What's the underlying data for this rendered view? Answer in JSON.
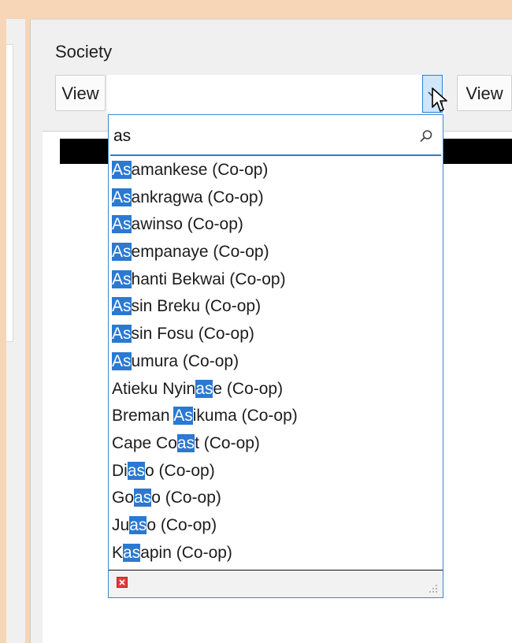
{
  "society": {
    "label": "Society",
    "view_left_label": "View",
    "view_right_label": "View",
    "search_value": "as",
    "items": [
      {
        "pre": "",
        "match": "As",
        "post": "amankese (Co-op)"
      },
      {
        "pre": "",
        "match": "As",
        "post": "ankragwa (Co-op)"
      },
      {
        "pre": "",
        "match": "As",
        "post": "awinso (Co-op)"
      },
      {
        "pre": "",
        "match": "As",
        "post": "empanaye (Co-op)"
      },
      {
        "pre": "",
        "match": "As",
        "post": "hanti Bekwai (Co-op)"
      },
      {
        "pre": "",
        "match": "As",
        "post": "sin Breku (Co-op)"
      },
      {
        "pre": "",
        "match": "As",
        "post": "sin Fosu (Co-op)"
      },
      {
        "pre": "",
        "match": "As",
        "post": "umura (Co-op)"
      },
      {
        "pre": "Atieku Nyin",
        "match": "as",
        "post": "e (Co-op)"
      },
      {
        "pre": "Breman ",
        "match": "As",
        "post": "ikuma (Co-op)"
      },
      {
        "pre": "Cape Co",
        "match": "as",
        "post": "t (Co-op)"
      },
      {
        "pre": "Di",
        "match": "as",
        "post": "o (Co-op)"
      },
      {
        "pre": "Go",
        "match": "as",
        "post": "o (Co-op)"
      },
      {
        "pre": "Ju",
        "match": "as",
        "post": "o (Co-op)"
      },
      {
        "pre": "K",
        "match": "as",
        "post": "apin (Co-op)"
      }
    ]
  },
  "icons": {
    "dropdown_arrow": "chevron-down-icon",
    "search": "search-icon",
    "clear": "clear-filter-icon",
    "resize": "resize-grip-icon",
    "cursor": "mouse-pointer-icon"
  },
  "colors": {
    "background": "#f6d6b6",
    "panel": "#f0f0f0",
    "highlight": "#2b79d1",
    "accent_border": "#3c86cf"
  }
}
